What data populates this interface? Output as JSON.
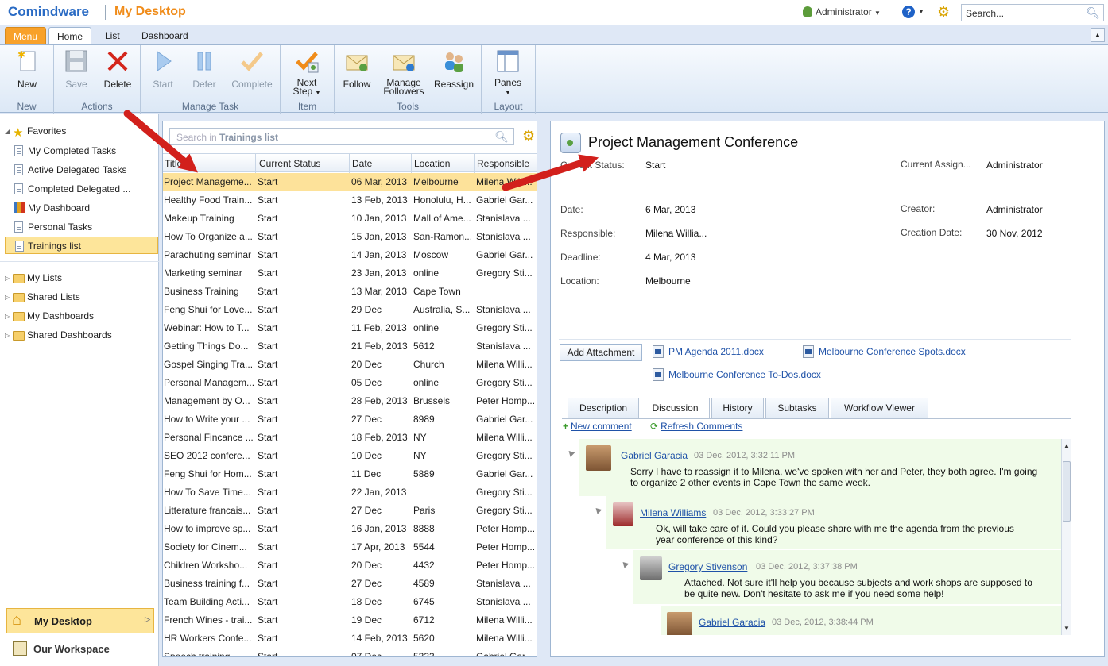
{
  "app": {
    "logo": "Comindware",
    "page_title": "My Desktop"
  },
  "topbar": {
    "user": "Administrator",
    "help": "?",
    "search_placeholder": "Search..."
  },
  "tabs": {
    "menu": "Menu",
    "home": "Home",
    "list": "List",
    "dashboard": "Dashboard"
  },
  "ribbon": {
    "new": "New",
    "group_new": "New",
    "save": "Save",
    "delete": "Delete",
    "group_actions": "Actions",
    "start": "Start",
    "defer": "Defer",
    "complete": "Complete",
    "group_manage": "Manage Task",
    "next_step": "Next",
    "next_step2": "Step",
    "group_item": "Item",
    "follow": "Follow",
    "manage_followers": "Manage",
    "manage_followers2": "Followers",
    "reassign": "Reassign",
    "group_tools": "Tools",
    "panes": "Panes",
    "group_layout": "Layout"
  },
  "nav": {
    "favorites": "Favorites",
    "items": [
      "My Completed Tasks",
      "Active Delegated Tasks",
      "Completed Delegated ...",
      "My Dashboard",
      "Personal Tasks",
      "Trainings list"
    ],
    "sections": [
      "My Lists",
      "Shared Lists",
      "My Dashboards",
      "Shared Dashboards"
    ],
    "my_desktop": "My Desktop",
    "our_workspace": "Our Workspace"
  },
  "list": {
    "search_prefix": "Search in ",
    "search_name": "Trainings list",
    "columns": [
      "Title",
      "Current Status",
      "Date",
      "Location",
      "Responsible"
    ],
    "rows": [
      [
        "Project Manageme...",
        "Start",
        "06 Mar, 2013",
        "Melbourne",
        "Milena Willi..."
      ],
      [
        "Healthy Food Train...",
        "Start",
        "13 Feb, 2013",
        "Honolulu, H...",
        "Gabriel Gar..."
      ],
      [
        "Makeup Training",
        "Start",
        "10 Jan, 2013",
        "Mall of Ame...",
        "Stanislava ..."
      ],
      [
        "How To Organize a...",
        "Start",
        "15 Jan, 2013",
        "San-Ramon...",
        "Stanislava ..."
      ],
      [
        "Parachuting seminar",
        "Start",
        "14 Jan, 2013",
        "Moscow",
        "Gabriel Gar..."
      ],
      [
        "Marketing seminar",
        "Start",
        "23 Jan, 2013",
        "online",
        "Gregory Sti..."
      ],
      [
        "Business Training",
        "Start",
        "13 Mar, 2013",
        "Cape Town",
        ""
      ],
      [
        "Feng Shui for Love...",
        "Start",
        "29 Dec",
        "Australia, S...",
        "Stanislava ..."
      ],
      [
        "Webinar: How to T...",
        "Start",
        "11 Feb, 2013",
        "online",
        "Gregory Sti..."
      ],
      [
        "Getting Things Do...",
        "Start",
        "21 Feb, 2013",
        "5612",
        "Stanislava ..."
      ],
      [
        "Gospel Singing Tra...",
        "Start",
        "20 Dec",
        "Church",
        "Milena Willi..."
      ],
      [
        "Personal Managem...",
        "Start",
        "05 Dec",
        "online",
        "Gregory Sti..."
      ],
      [
        "Management by O...",
        "Start",
        "28 Feb, 2013",
        "Brussels",
        "Peter Homp..."
      ],
      [
        "How to Write your ...",
        "Start",
        "27 Dec",
        "8989",
        "Gabriel Gar..."
      ],
      [
        "Personal Fincance ...",
        "Start",
        "18 Feb, 2013",
        "NY",
        "Milena Willi..."
      ],
      [
        "SEO 2012 confere...",
        "Start",
        "10 Dec",
        "NY",
        "Gregory Sti..."
      ],
      [
        "Feng Shui for Hom...",
        "Start",
        "11 Dec",
        "5889",
        "Gabriel Gar..."
      ],
      [
        "How To Save Time...",
        "Start",
        "22 Jan, 2013",
        "",
        "Gregory Sti..."
      ],
      [
        "Litterature francais...",
        "Start",
        "27 Dec",
        "Paris",
        "Gregory Sti..."
      ],
      [
        "How to improve sp...",
        "Start",
        "16 Jan, 2013",
        "8888",
        "Peter Homp..."
      ],
      [
        "Society for Cinem...",
        "Start",
        "17 Apr, 2013",
        "5544",
        "Peter Homp..."
      ],
      [
        "Children Worksho...",
        "Start",
        "20 Dec",
        "4432",
        "Peter Homp..."
      ],
      [
        "Business training f...",
        "Start",
        "27 Dec",
        "4589",
        "Stanislava ..."
      ],
      [
        "Team Building Acti...",
        "Start",
        "18 Dec",
        "6745",
        "Stanislava ..."
      ],
      [
        "French Wines - trai...",
        "Start",
        "19 Dec",
        "6712",
        "Milena Willi..."
      ],
      [
        "HR Workers Confe...",
        "Start",
        "14 Feb, 2013",
        "5620",
        "Milena Willi..."
      ],
      [
        "Speech training",
        "Start",
        "07 Dec",
        "5333",
        "Gabriel Gar..."
      ]
    ]
  },
  "detail": {
    "title": "Project Management Conference",
    "labels": {
      "status": "Current Status:",
      "assignee": "Current Assign...",
      "date": "Date:",
      "creator": "Creator:",
      "responsible": "Responsible:",
      "creation_date": "Creation Date:",
      "deadline": "Deadline:",
      "location": "Location:"
    },
    "values": {
      "status": "Start",
      "assignee": "Administrator",
      "date": "6 Mar, 2013",
      "creator": "Administrator",
      "responsible": "Milena Willia...",
      "creation_date": "30 Nov, 2012",
      "deadline": "4 Mar, 2013",
      "location": "Melbourne"
    },
    "add_attachment": "Add Attachment",
    "attachments": [
      "PM Agenda 2011.docx",
      "Melbourne Conference Spots.docx",
      "Melbourne Conference To-Dos.docx"
    ],
    "tabs": [
      "Description",
      "Discussion",
      "History",
      "Subtasks",
      "Workflow Viewer"
    ],
    "new_comment": "New comment",
    "refresh_comments": "Refresh Comments",
    "comments": [
      {
        "author": "Gabriel Garacia",
        "time": "03 Dec, 2012, 3:32:11 PM",
        "text": "Sorry I have to reassign it to Milena, we've spoken with her and Peter, they both agree. I'm going to organize 2 other events in Cape Town the same week."
      },
      {
        "author": "Milena Williams",
        "time": "03 Dec, 2012, 3:33:27 PM",
        "text": "Ok, will take care of it. Could you please share with me the agenda from the previous year conference of this kind?"
      },
      {
        "author": "Gregory Stivenson",
        "time": "03 Dec, 2012, 3:37:38 PM",
        "text": "Attached. Not sure it'll help you because subjects and work shops are supposed to be quite new. Don't hesitate to ask me if you need some help!"
      },
      {
        "author": "Gabriel Garacia",
        "time": "03 Dec, 2012, 3:38:44 PM",
        "text": ""
      }
    ]
  },
  "colors": {
    "accent": "#f08c1a",
    "brand": "#2a6bc4",
    "selection": "#fde29a",
    "arrow": "#d2201c"
  }
}
